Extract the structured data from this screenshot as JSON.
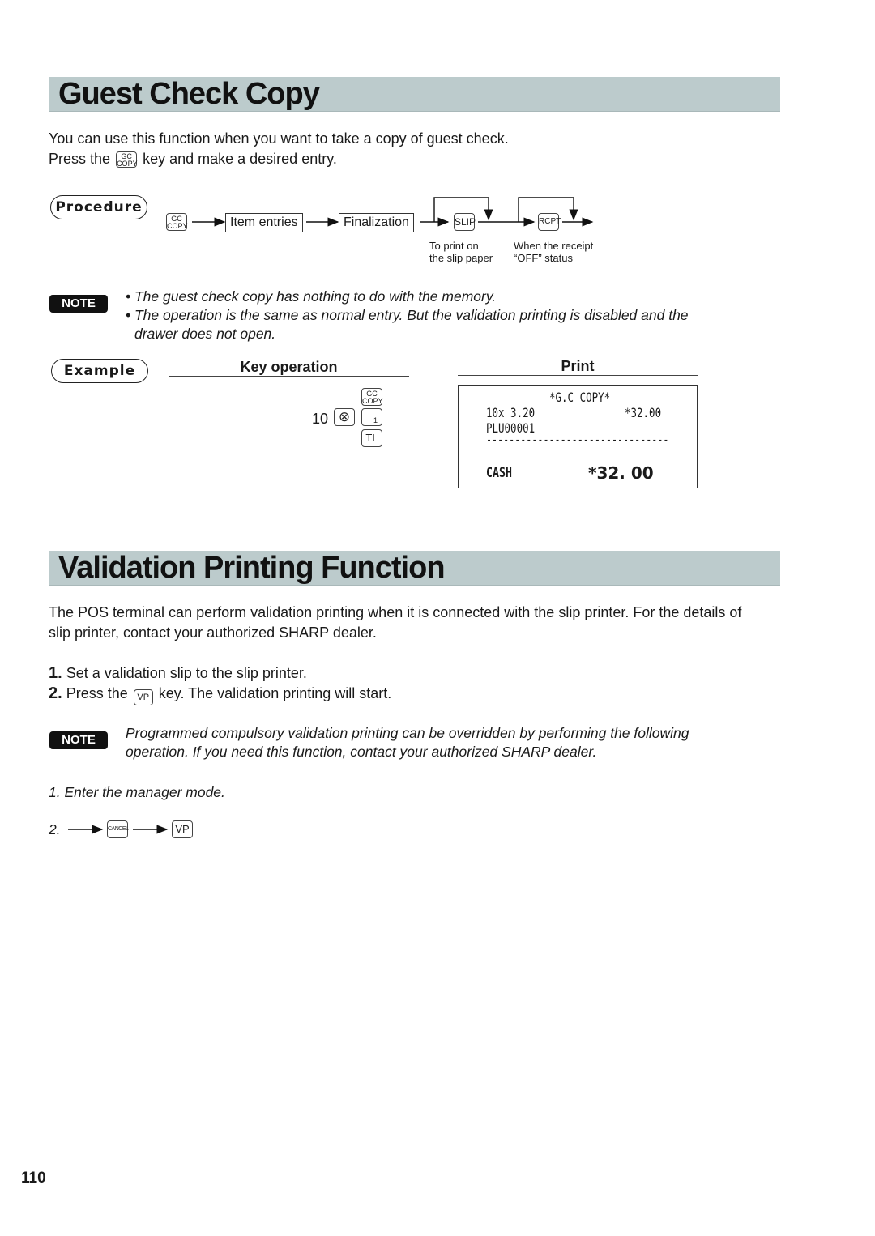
{
  "section1": {
    "title": "Guest Check Copy",
    "intro_line1": "You can use this function when you want to take a copy of guest check.",
    "intro_line2_pre": "Press the",
    "intro_line2_post": "key and make a desired entry.",
    "key_gc_copy": {
      "top": "GC",
      "bottom": "COPY"
    },
    "procedure": {
      "label": "Procedure",
      "steps": [
        "Item entries",
        "Finalization"
      ],
      "slip_key": "SLIP",
      "rcpt_key": "RCPT",
      "slip_note_line1": "To print on",
      "slip_note_line2": "the slip paper",
      "rcpt_note_line1": "When the receipt",
      "rcpt_note_line2": "“OFF” status"
    },
    "note": {
      "badge": "NOTE",
      "bullets": [
        "• The guest check copy has nothing to do with the memory.",
        "• The operation is the same as normal entry.  But the validation printing is disabled and the",
        "drawer does not open."
      ]
    },
    "example": {
      "label": "Example",
      "key_operation_header": "Key operation",
      "print_header": "Print",
      "quantity": "10",
      "multiply_symbol": "⊗",
      "plu_key": "1",
      "tl_key": "TL",
      "receipt": {
        "title": "*G.C COPY*",
        "line1_left": "10x 3.20",
        "line1_right": "*32.00",
        "line2": "PLU00001",
        "separator": "--------------------------------",
        "total_label": "CASH",
        "total_value": "*32. 00"
      }
    }
  },
  "section2": {
    "title": "Validation Printing Function",
    "intro_line1": "The POS terminal can perform validation printing when it is connected with the slip printer. For the details of",
    "intro_line2": "slip printer, contact your authorized SHARP dealer.",
    "steps": [
      {
        "num": "1.",
        "text": "Set a validation slip to the slip printer."
      },
      {
        "num": "2.",
        "pre": "Press the",
        "key": "VP",
        "post": "key. The validation printing will start."
      }
    ],
    "note": {
      "badge": "NOTE",
      "line1": "Programmed compulsory validation printing can be overridden by performing the following",
      "line2": "operation.  If you need this function, contact your authorized SHARP dealer."
    },
    "manager_step1": "1. Enter the manager mode.",
    "manager_step2_num": "2.",
    "cancel_key": "CANCEL",
    "vp_key": "VP"
  },
  "page_number": "110"
}
